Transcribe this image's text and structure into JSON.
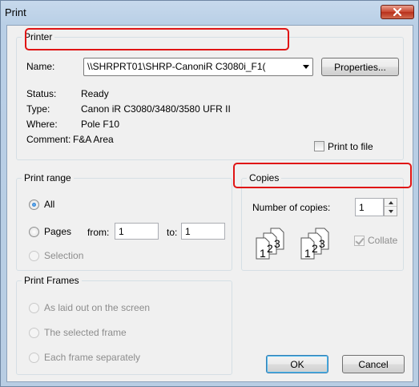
{
  "window": {
    "title": "Print"
  },
  "printer": {
    "group_label": "Printer",
    "name_label": "Name:",
    "name_value": "\\\\SHRPRT01\\SHRP-CanoniR C3080i_F1(",
    "properties_label": "Properties...",
    "status_label": "Status:",
    "status_value": "Ready",
    "type_label": "Type:",
    "type_value": "Canon iR C3080/3480/3580 UFR II",
    "where_label": "Where:",
    "where_value": "Pole F10",
    "comment_label": "Comment:",
    "comment_value": "F&A Area",
    "print_to_file_label": "Print to file"
  },
  "print_range": {
    "group_label": "Print range",
    "all_label": "All",
    "pages_label": "Pages",
    "from_label": "from:",
    "from_value": "1",
    "to_label": "to:",
    "to_value": "1",
    "selection_label": "Selection",
    "selected": "All"
  },
  "copies": {
    "group_label": "Copies",
    "number_label": "Number of copies:",
    "number_value": "1",
    "collate_label": "Collate",
    "collate_checked": true,
    "page_digits": [
      "1",
      "2",
      "3"
    ]
  },
  "print_frames": {
    "group_label": "Print Frames",
    "options": [
      "As laid out on the screen",
      "The selected frame",
      "Each frame separately"
    ]
  },
  "buttons": {
    "ok_label": "OK",
    "cancel_label": "Cancel"
  },
  "colors": {
    "highlight": "#e01414",
    "titlebar": "#c7d9ec",
    "close_button": "#c8452f"
  },
  "icons": [
    "close-icon",
    "dropdown-arrow-icon",
    "spin-up-icon",
    "spin-down-icon",
    "collate-pages-icon"
  ]
}
